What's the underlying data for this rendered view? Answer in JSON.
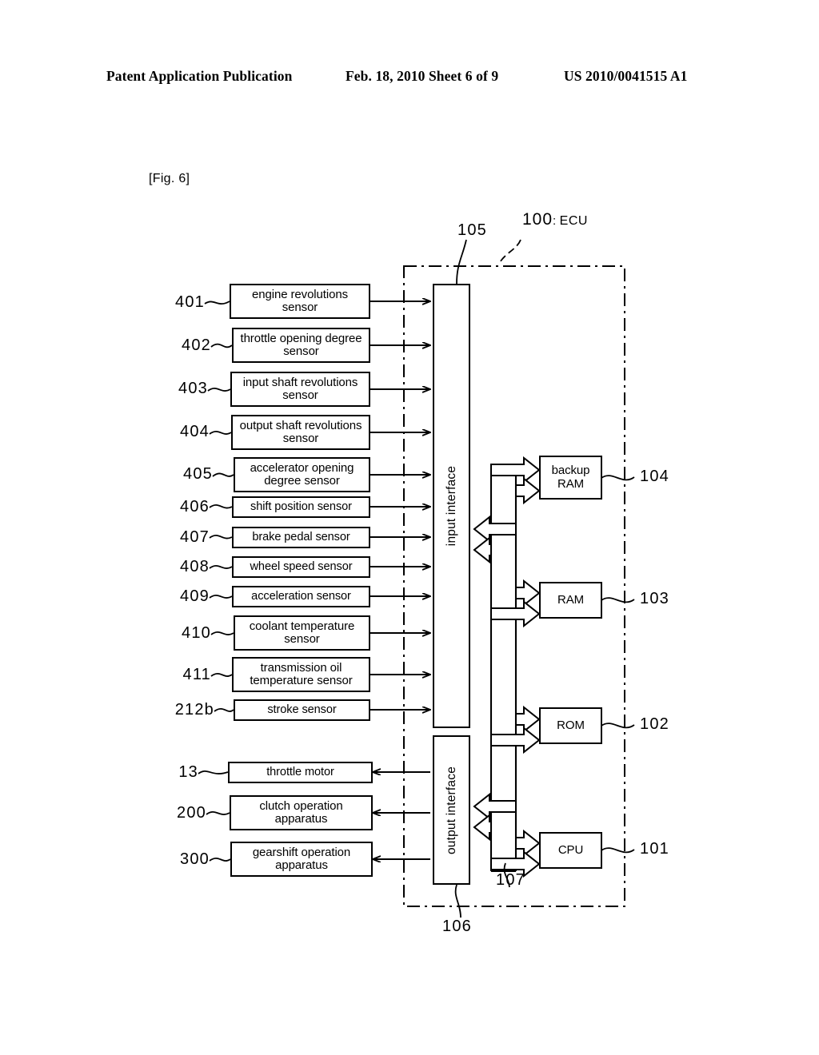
{
  "header": {
    "left": "Patent Application Publication",
    "middle": "Feb. 18, 2010  Sheet 6 of 9",
    "right": "US 2010/0041515 A1"
  },
  "figure": {
    "label": "[Fig. 6]",
    "ecu_ref": "100",
    "ecu_separator": ":",
    "ecu_name": "ECU"
  },
  "sensors": [
    {
      "ref": "401",
      "label": "engine revolutions sensor"
    },
    {
      "ref": "402",
      "label": "throttle opening degree sensor"
    },
    {
      "ref": "403",
      "label": "input shaft revolutions sensor"
    },
    {
      "ref": "404",
      "label": "output shaft revolutions sensor"
    },
    {
      "ref": "405",
      "label": "accelerator opening degree sensor"
    },
    {
      "ref": "406",
      "label": "shift position sensor"
    },
    {
      "ref": "407",
      "label": "brake pedal sensor"
    },
    {
      "ref": "408",
      "label": "wheel speed sensor"
    },
    {
      "ref": "409",
      "label": "acceleration sensor"
    },
    {
      "ref": "410",
      "label": "coolant temperature sensor"
    },
    {
      "ref": "411",
      "label": "transmission oil temperature sensor"
    },
    {
      "ref": "212b",
      "label": "stroke sensor"
    }
  ],
  "actuators": [
    {
      "ref": "13",
      "label": "throttle motor"
    },
    {
      "ref": "200",
      "label": "clutch operation apparatus"
    },
    {
      "ref": "300",
      "label": "gearshift operation apparatus"
    }
  ],
  "interfaces": {
    "input": {
      "ref": "105",
      "label": "input interface"
    },
    "output": {
      "ref": "106",
      "label": "output interface"
    }
  },
  "memories": [
    {
      "ref": "104",
      "label": "backup RAM"
    },
    {
      "ref": "103",
      "label": "RAM"
    },
    {
      "ref": "102",
      "label": "ROM"
    },
    {
      "ref": "101",
      "label": "CPU"
    }
  ],
  "bus": {
    "ref": "107"
  }
}
